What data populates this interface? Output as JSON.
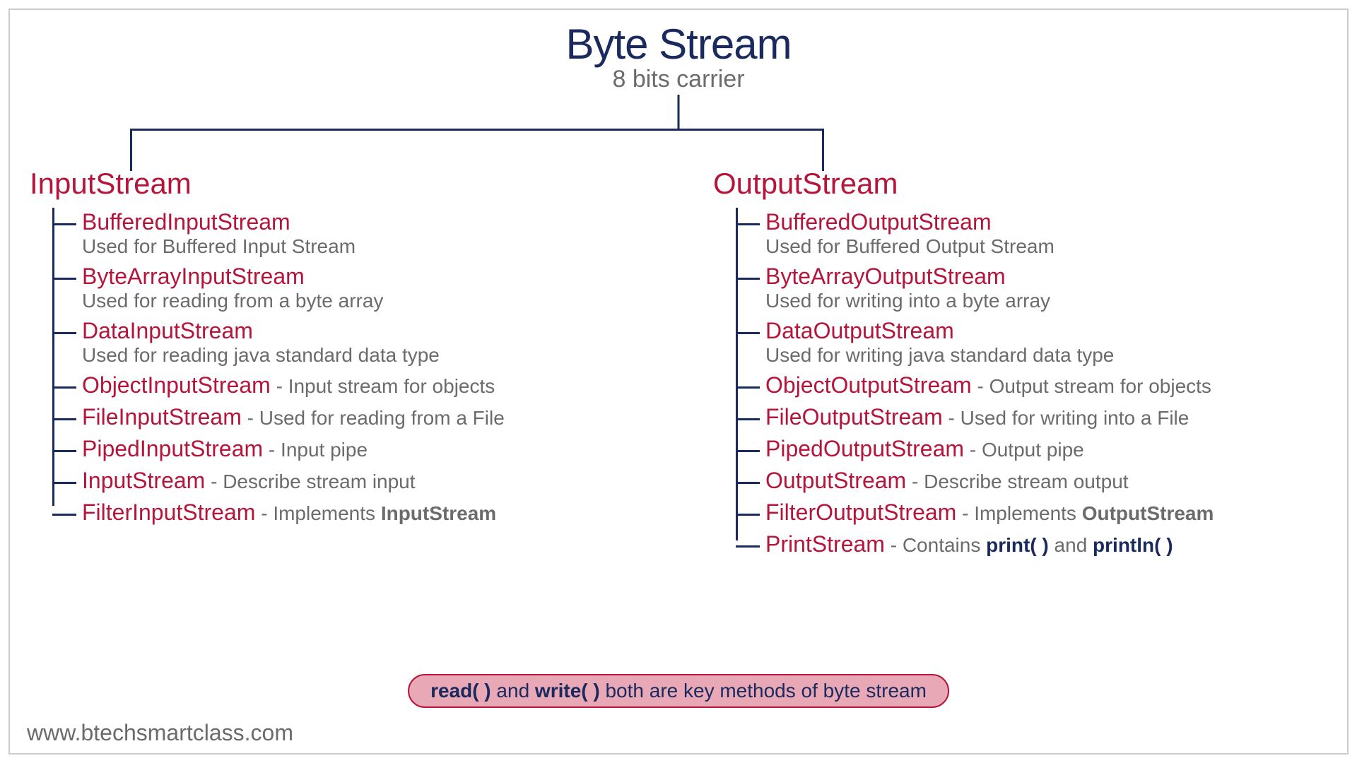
{
  "header": {
    "title": "Byte Stream",
    "subtitle": "8 bits carrier"
  },
  "input": {
    "title": "InputStream",
    "nodes": [
      {
        "name": "BufferedInputStream",
        "desc": "Used for Buffered Input Stream",
        "inline": false
      },
      {
        "name": "ByteArrayInputStream",
        "desc": "Used for reading from a byte array",
        "inline": false
      },
      {
        "name": "DataInputStream",
        "desc": "Used for reading java standard data type",
        "inline": false
      },
      {
        "name": "ObjectInputStream",
        "desc": "Input stream for objects",
        "inline": true
      },
      {
        "name": "FileInputStream",
        "desc": "Used for reading from a File",
        "inline": true
      },
      {
        "name": "PipedInputStream",
        "desc": "Input pipe",
        "inline": true
      },
      {
        "name": "InputStream",
        "desc": "Describe stream input",
        "inline": true
      },
      {
        "name": "FilterInputStream",
        "desc_html": "Implements <span class='bold-gray'>InputStream</span>",
        "inline": true
      }
    ]
  },
  "output": {
    "title": "OutputStream",
    "nodes": [
      {
        "name": "BufferedOutputStream",
        "desc": "Used for Buffered Output Stream",
        "inline": false
      },
      {
        "name": "ByteArrayOutputStream",
        "desc": "Used for writing into a byte array",
        "inline": false
      },
      {
        "name": "DataOutputStream",
        "desc": "Used for writing java standard data type",
        "inline": false
      },
      {
        "name": "ObjectOutputStream",
        "desc": "Output stream for objects",
        "inline": true
      },
      {
        "name": "FileOutputStream",
        "desc": "Used for writing into a File",
        "inline": true
      },
      {
        "name": "PipedOutputStream",
        "desc": "Output pipe",
        "inline": true
      },
      {
        "name": "OutputStream",
        "desc": "Describe stream output",
        "inline": true
      },
      {
        "name": "FilterOutputStream",
        "desc_html": "Implements <span class='bold-gray'>OutputStream</span>",
        "inline": true
      },
      {
        "name": "PrintStream",
        "desc_html": "Contains <span class='bold-dark'>print( )</span> and <span class='bold-dark'>println( )</span>",
        "inline": true
      }
    ]
  },
  "footer": {
    "pill_html": "<span class='kw'>read( )</span> and <span class='kw'>write( )</span> both are key methods of byte stream",
    "credit": "www.btechsmartclass.com"
  }
}
